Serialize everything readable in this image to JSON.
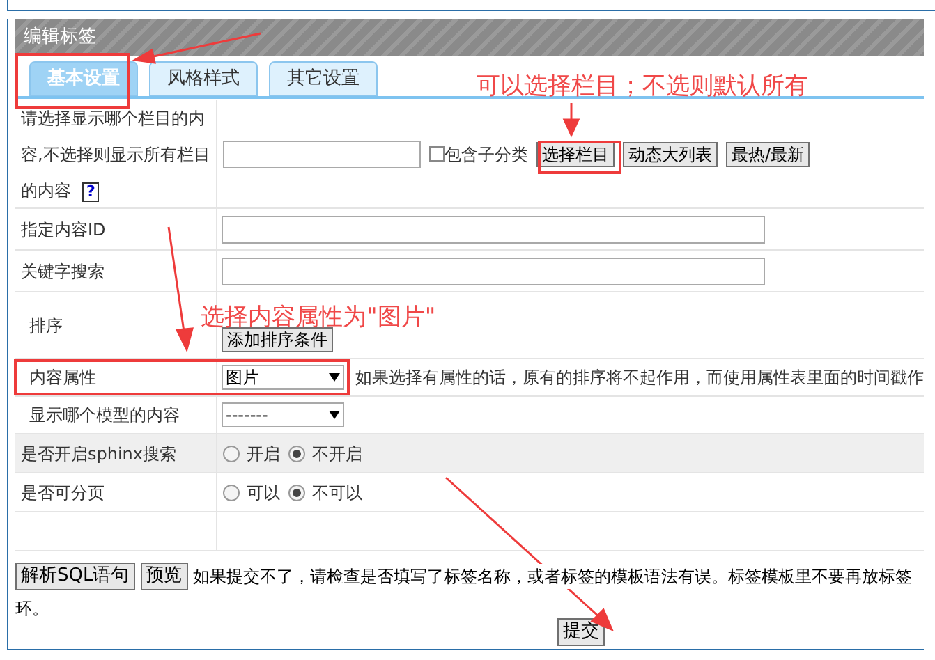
{
  "panel": {
    "title": "编辑标签"
  },
  "tabs": [
    {
      "label": "基本设置",
      "selected": true
    },
    {
      "label": "风格样式",
      "selected": false
    },
    {
      "label": "其它设置",
      "selected": false
    }
  ],
  "rows": [
    {
      "kind": "column_picker",
      "label": "请选择显示哪个栏目的内容,不选择则显示所有栏目的内容",
      "help": "?",
      "checkbox": {
        "label": "包含子分类",
        "checked": false
      },
      "buttons": [
        "选择栏目",
        "动态大列表",
        "最热/最新"
      ]
    },
    {
      "kind": "text",
      "label": "指定内容ID"
    },
    {
      "kind": "text",
      "label": "关键字搜索"
    },
    {
      "kind": "sort",
      "label": "排序",
      "button": "添加排序条件"
    },
    {
      "kind": "select",
      "label": "内容属性",
      "value": "图片",
      "note": "如果选择有属性的话，原有的排序将不起作用，而使用属性表里面的时间戳作"
    },
    {
      "kind": "select",
      "label": "显示哪个模型的内容",
      "value": "-------"
    },
    {
      "kind": "radio",
      "label": "是否开启sphinx搜索",
      "shaded": true,
      "options": [
        {
          "label": "开启",
          "selected": false
        },
        {
          "label": "不开启",
          "selected": true
        }
      ]
    },
    {
      "kind": "radio",
      "label": "是否可分页",
      "shaded": false,
      "options": [
        {
          "label": "可以",
          "selected": false
        },
        {
          "label": "不可以",
          "selected": true
        }
      ]
    },
    {
      "kind": "empty"
    }
  ],
  "footer": {
    "buttons": [
      "解析SQL语句",
      "预览"
    ],
    "note": [
      "如果提交不了，请检查是否填写了标签名称，或者标签的模板语法有误。标签模板里不要再放标签",
      "环。"
    ],
    "submit": "提交"
  },
  "annotations": [
    {
      "text": "可以选择栏目；不选则默认所有"
    },
    {
      "text": "选择内容属性为\"图片\""
    }
  ]
}
